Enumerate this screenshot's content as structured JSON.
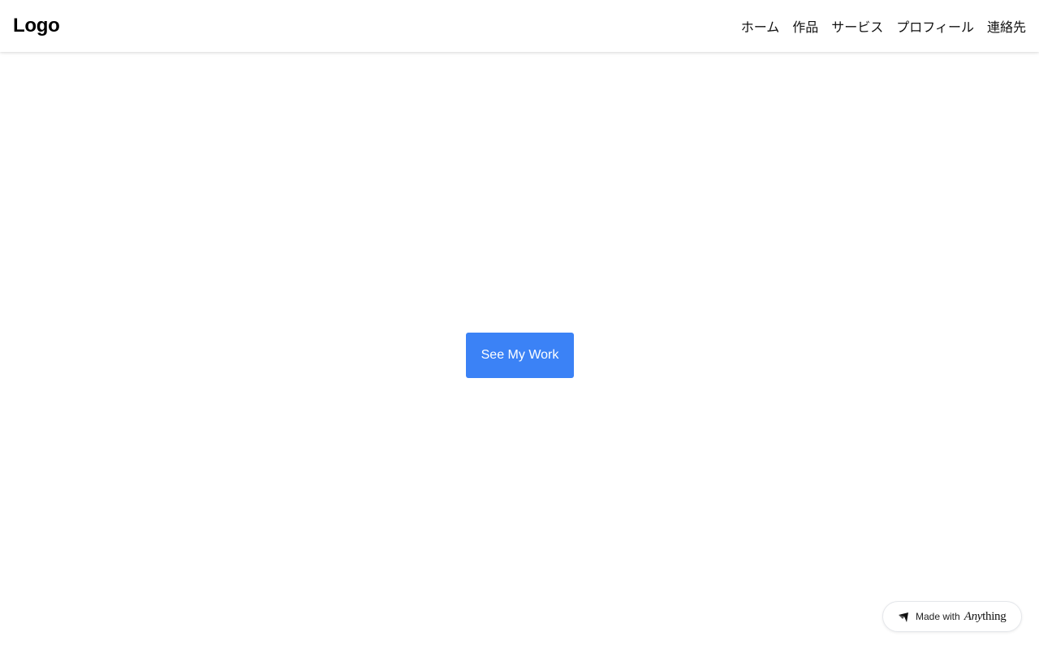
{
  "header": {
    "logo_text": "Logo",
    "nav": [
      {
        "label": "ホーム"
      },
      {
        "label": "作品"
      },
      {
        "label": "サービス"
      },
      {
        "label": "プロフィール"
      },
      {
        "label": "連絡先"
      }
    ]
  },
  "hero": {
    "cta_label": "See My Work"
  },
  "badge": {
    "prefix": "Made with",
    "brand_italic": "Any",
    "brand_rest": "thing",
    "icon": "anything-logo-icon"
  },
  "colors": {
    "accent": "#3b82f6",
    "background": "#ffffff",
    "text": "#111111"
  }
}
